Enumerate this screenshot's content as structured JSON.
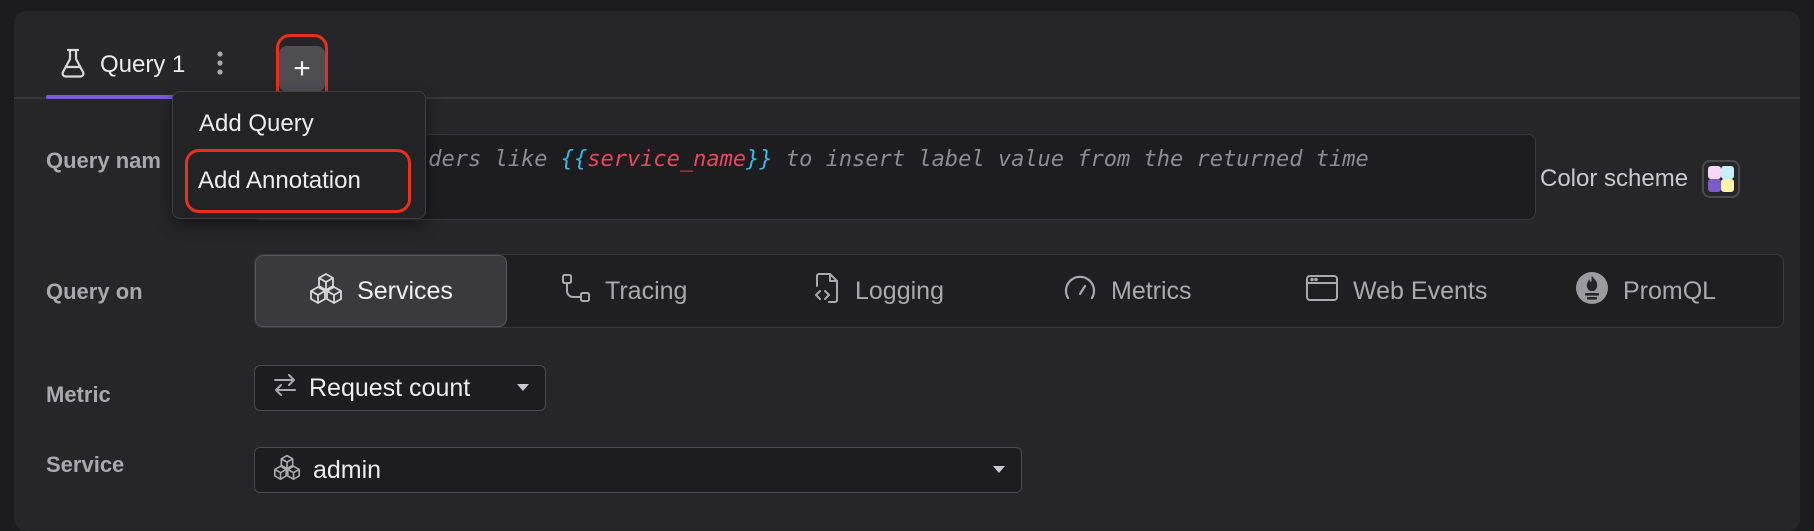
{
  "tabs": {
    "active_label": "Query 1",
    "add_symbol": "+"
  },
  "menu": {
    "items": [
      "Add Query",
      "Add Annotation"
    ]
  },
  "query_name": {
    "label": "Query nam",
    "placeholder_lead": "lders like ",
    "placeholder_brace_open": "{{",
    "placeholder_var": "service_name",
    "placeholder_brace_close": "}}",
    "placeholder_tail": " to insert label value from the returned time"
  },
  "color_scheme": {
    "label": "Color scheme",
    "colors": [
      "#f7d7f5",
      "#fbf3a6",
      "#7b5cc4",
      "#c6f0f8"
    ]
  },
  "query_on": {
    "label": "Query on",
    "options": [
      "Services",
      "Tracing",
      "Logging",
      "Metrics",
      "Web Events",
      "PromQL"
    ],
    "selected": "Services"
  },
  "metric": {
    "label": "Metric",
    "value": "Request count"
  },
  "service": {
    "label": "Service",
    "value": "admin"
  },
  "colors": {
    "accent": "#7c5cd6",
    "highlight": "#e8301c"
  }
}
